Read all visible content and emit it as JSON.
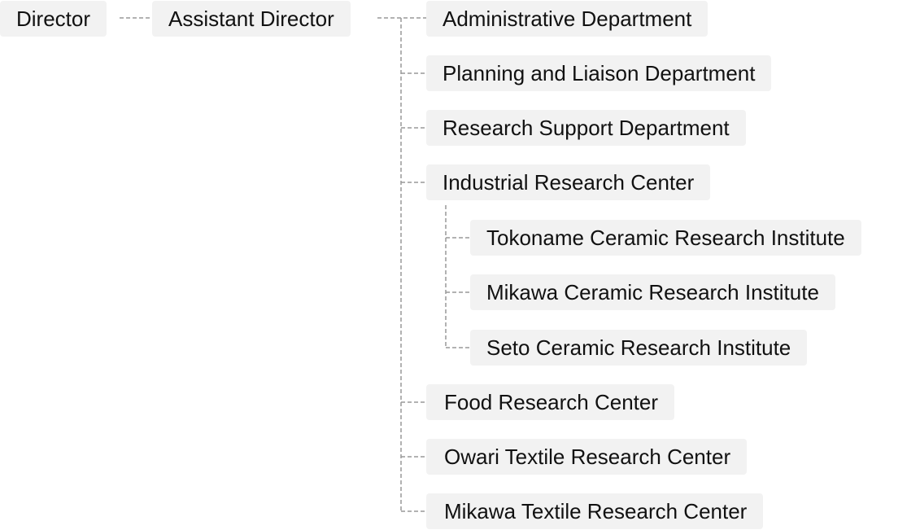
{
  "root": {
    "label": "Director"
  },
  "assistant": {
    "label": "Assistant Director"
  },
  "departments": [
    {
      "label": "Administrative Department"
    },
    {
      "label": "Planning and Liaison Department"
    },
    {
      "label": "Research Support Department"
    },
    {
      "label": "Industrial Research Center"
    },
    {
      "label": "Food Research Center"
    },
    {
      "label": "Owari Textile Research Center"
    },
    {
      "label": "Mikawa Textile Research Center"
    }
  ],
  "institutes": [
    {
      "label": "Tokoname Ceramic Research Institute"
    },
    {
      "label": "Mikawa Ceramic Research Institute"
    },
    {
      "label": "Seto Ceramic Research Institute"
    }
  ],
  "colors": {
    "node_bg": "#f2f2f2",
    "connector": "#999999",
    "text": "#111111"
  }
}
